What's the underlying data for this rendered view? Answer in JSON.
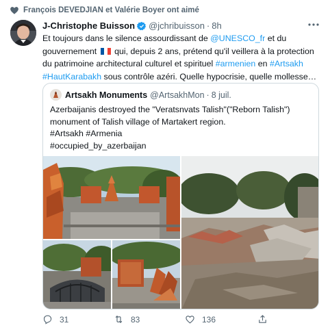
{
  "social_context": "François DEVEDJIAN et Valérie Boyer ont aimé",
  "tweet": {
    "author_name": "J-Christophe Buisson",
    "handle": "@jchribuisson",
    "dot": "·",
    "time": "8h",
    "text": {
      "p1": "Et toujours dans le silence assourdissant de ",
      "mention1": "@UNESCO_fr",
      "p2": " et du gouvernement ",
      "p3": " qui, depuis 2 ans, prétend qu'il veillera à la protection du patrimoine architectural culturel et spirituel ",
      "hashtag1": "#armenien",
      "p4": " en ",
      "hashtag2": "#Artsakh",
      "hashtag3": "#HautKarabakh",
      "p5": " sous contrôle azéri. Quelle hypocrisie, quelle mollesse…"
    }
  },
  "quote": {
    "name": "Artsakh Monuments",
    "handle": "@ArtsakhMon",
    "dot": "·",
    "time": "8 juil.",
    "lines": [
      "Azerbaijanis destroyed the \"Veratsnvats Talish\"(\"Reborn Talish\")",
      "monument of Talish village of Martakert region.",
      "#Artsakh #Armenia",
      "#occupied_by_azerbaijan"
    ]
  },
  "actions": {
    "reply_count": "31",
    "retweet_count": "83",
    "like_count": "136"
  },
  "colors": {
    "link": "#1d9bf0",
    "secondary_text": "#536471",
    "border": "#cfd9de",
    "verified": "#1d9bf0"
  }
}
